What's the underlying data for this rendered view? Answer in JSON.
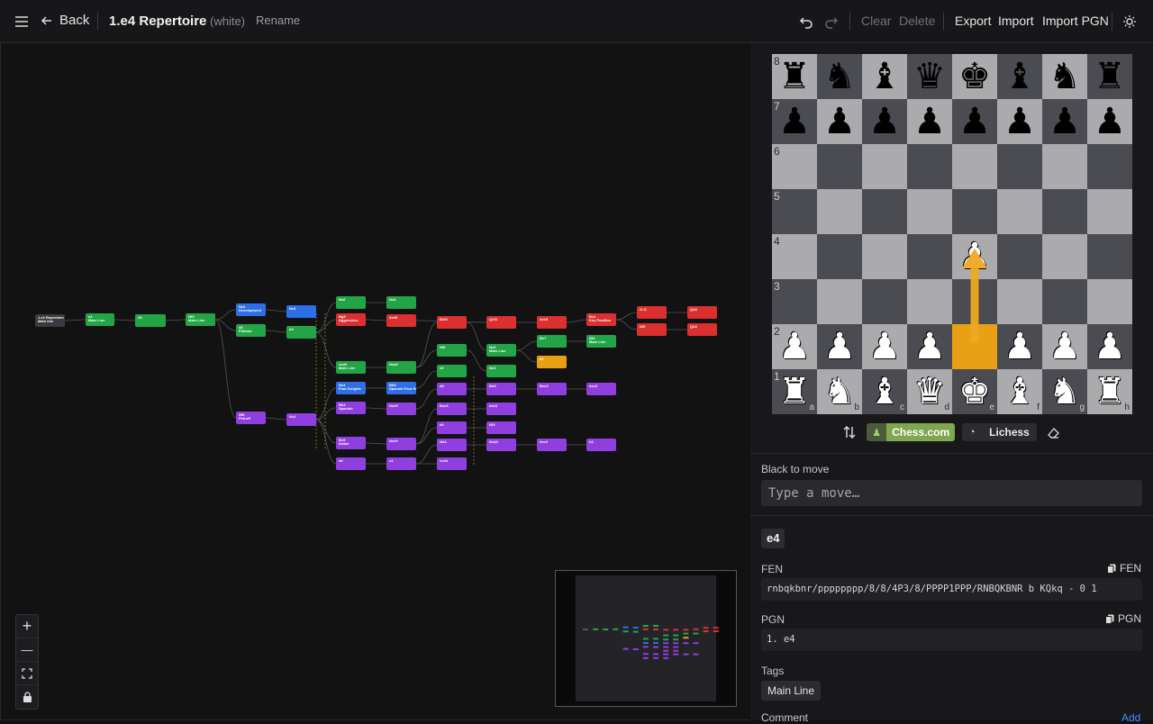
{
  "header": {
    "back_label": "Back",
    "title": "1.e4 Repertoire",
    "side": "(white)",
    "rename": "Rename",
    "clear": "Clear",
    "delete": "Delete",
    "export": "Export",
    "import": "Import",
    "import_pgn": "Import PGN"
  },
  "tree": {
    "root": {
      "label": "1.e4 Repertoire",
      "sub": "Main line"
    },
    "nodes": [
      {
        "id": "n1",
        "label": "e4",
        "sub": "Main Line",
        "color": "green"
      },
      {
        "id": "n2",
        "label": "e5",
        "sub": "",
        "color": "green"
      },
      {
        "id": "n3",
        "label": "Nf3",
        "sub": "Main Line",
        "color": "green"
      },
      {
        "id": "n4",
        "label": "Nc6",
        "sub": "Development",
        "color": "blue"
      },
      {
        "id": "n5",
        "label": "d6",
        "sub": "Philidor",
        "color": "green"
      },
      {
        "id": "n6",
        "label": "Nf6",
        "sub": "Petroff",
        "color": "purple"
      },
      {
        "id": "n7",
        "label": "Nc3",
        "sub": "",
        "color": "blue"
      },
      {
        "id": "n8",
        "label": "d4",
        "sub": "",
        "color": "green"
      },
      {
        "id": "n9",
        "label": "Nc3",
        "sub": "",
        "color": "purple"
      },
      {
        "id": "n10",
        "label": "Nc6",
        "sub": "",
        "color": "green"
      },
      {
        "id": "n11",
        "label": "Bg5",
        "sub": "Aggressive",
        "color": "red"
      },
      {
        "id": "n12",
        "label": "exd4",
        "sub": "Main Line",
        "color": "green"
      },
      {
        "id": "n13",
        "label": "Nc4",
        "sub": "Four Knights",
        "color": "blue"
      },
      {
        "id": "n14",
        "label": "Bb4",
        "sub": "Spanish",
        "color": "purple"
      },
      {
        "id": "n15",
        "label": "Bc5",
        "sub": "Italian",
        "color": "purple"
      },
      {
        "id": "n16",
        "label": "d6",
        "sub": "",
        "color": "purple"
      },
      {
        "id": "n17",
        "label": "Nc3",
        "sub": "",
        "color": "green"
      },
      {
        "id": "n18",
        "label": "dxe5",
        "sub": "",
        "color": "red"
      },
      {
        "id": "n19",
        "label": "Nxd4",
        "sub": "",
        "color": "green"
      },
      {
        "id": "n20",
        "label": "Bb5",
        "sub": "Spanish Four Knights",
        "color": "blue"
      },
      {
        "id": "n21",
        "label": "Nxe5",
        "sub": "",
        "color": "purple"
      },
      {
        "id": "n22",
        "label": "Nxe5",
        "sub": "",
        "color": "purple"
      },
      {
        "id": "n23",
        "label": "c3",
        "sub": "",
        "color": "purple"
      },
      {
        "id": "n24",
        "label": "Bxf3",
        "sub": "",
        "color": "red"
      },
      {
        "id": "n25",
        "label": "Nf6",
        "sub": "",
        "color": "green"
      },
      {
        "id": "n26",
        "label": "c6",
        "sub": "",
        "color": "green"
      },
      {
        "id": "n27",
        "label": "d6",
        "sub": "",
        "color": "purple"
      },
      {
        "id": "n28",
        "label": "Bxc3",
        "sub": "",
        "color": "purple"
      },
      {
        "id": "n29",
        "label": "d6",
        "sub": "",
        "color": "purple"
      },
      {
        "id": "n30",
        "label": "Nd4",
        "sub": "",
        "color": "purple"
      },
      {
        "id": "n31",
        "label": "exd4",
        "sub": "",
        "color": "purple"
      },
      {
        "id": "n32",
        "label": "Qxf3",
        "sub": "",
        "color": "red"
      },
      {
        "id": "n33",
        "label": "Nc3",
        "sub": "Main Line",
        "color": "green"
      },
      {
        "id": "n34",
        "label": "Nc3",
        "sub": "",
        "color": "green"
      },
      {
        "id": "n35",
        "label": "Bd3",
        "sub": "",
        "color": "purple"
      },
      {
        "id": "n36",
        "label": "dxc3",
        "sub": "",
        "color": "purple"
      },
      {
        "id": "n37",
        "label": "Nf3",
        "sub": "",
        "color": "purple"
      },
      {
        "id": "n38",
        "label": "Nxd4",
        "sub": "",
        "color": "purple"
      },
      {
        "id": "n39",
        "label": "dxe5",
        "sub": "",
        "color": "red"
      },
      {
        "id": "n40",
        "label": "Be7",
        "sub": "",
        "color": "green"
      },
      {
        "id": "n41",
        "label": "a6",
        "sub": "",
        "color": "orange"
      },
      {
        "id": "n42",
        "label": "Bxc3",
        "sub": "",
        "color": "purple"
      },
      {
        "id": "n43",
        "label": "dxc3",
        "sub": "",
        "color": "purple"
      },
      {
        "id": "n44",
        "label": "Bc4",
        "sub": "Key Position",
        "color": "red"
      },
      {
        "id": "n45",
        "label": "Bf4",
        "sub": "Main Line",
        "color": "green"
      },
      {
        "id": "n46",
        "label": "dxc3",
        "sub": "",
        "color": "purple"
      },
      {
        "id": "n47",
        "label": "O-O",
        "sub": "",
        "color": "red"
      },
      {
        "id": "n48",
        "label": "Nf6",
        "sub": "",
        "color": "red"
      },
      {
        "id": "n49",
        "label": "Qb3",
        "sub": "",
        "color": "red"
      },
      {
        "id": "n50",
        "label": "Qb3",
        "sub": "",
        "color": "red"
      },
      {
        "id": "n51",
        "label": "h3",
        "sub": "",
        "color": "purple"
      }
    ]
  },
  "zoom": {
    "in": "+",
    "out": "—"
  },
  "board": {
    "ranks": [
      "8",
      "7",
      "6",
      "5",
      "4",
      "3",
      "2",
      "1"
    ],
    "files": [
      "a",
      "b",
      "c",
      "d",
      "e",
      "f",
      "g",
      "h"
    ],
    "position": [
      [
        "br",
        "bn",
        "bb",
        "bq",
        "bk",
        "bb",
        "bn",
        "br"
      ],
      [
        "bp",
        "bp",
        "bp",
        "bp",
        "bp",
        "bp",
        "bp",
        "bp"
      ],
      [
        "",
        "",
        "",
        "",
        "",
        "",
        "",
        ""
      ],
      [
        "",
        "",
        "",
        "",
        "",
        "",
        "",
        ""
      ],
      [
        "",
        "",
        "",
        "",
        "wp",
        "",
        "",
        ""
      ],
      [
        "",
        "",
        "",
        "",
        "",
        "",
        "",
        ""
      ],
      [
        "wp",
        "wp",
        "wp",
        "wp",
        "",
        "wp",
        "wp",
        "wp"
      ],
      [
        "wr",
        "wn",
        "wb",
        "wq",
        "wk",
        "wb",
        "wn",
        "wr"
      ]
    ],
    "highlight_square": "e2",
    "arrow": {
      "from": "e2",
      "to": "e4",
      "color": "#f0a820"
    },
    "chesscom_label": "Chess.com",
    "lichess_label": "Lichess"
  },
  "panel": {
    "turn_label": "Black to move",
    "move_placeholder": "Type a move…",
    "current_move": "e4",
    "fen_label": "FEN",
    "fen_copy": "FEN",
    "fen_value": "rnbqkbnr/pppppppp/8/8/4P3/8/PPPP1PPP/RNBQKBNR b KQkq - 0 1",
    "pgn_label": "PGN",
    "pgn_copy": "PGN",
    "pgn_value": "1. e4",
    "tags_label": "Tags",
    "tag": "Main Line",
    "comment_label": "Comment",
    "add_label": "Add"
  }
}
